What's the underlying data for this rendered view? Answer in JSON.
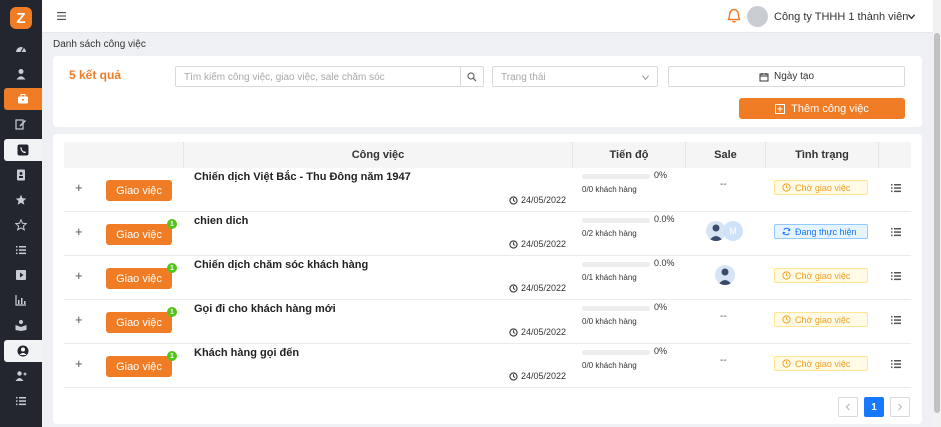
{
  "app": {
    "logo_letter": "Z"
  },
  "topbar": {
    "company": "Công ty THHH 1 thành viên"
  },
  "breadcrumb": "Danh sách công việc",
  "filters": {
    "result_count": "5 kết quả",
    "search_placeholder": "Tìm kiếm công việc, giao việc, sale chăm sóc",
    "status_placeholder": "Trạng thái",
    "date_label": "Ngày tạo",
    "add_label": "Thêm công việc"
  },
  "table": {
    "headers": {
      "task": "Công việc",
      "progress": "Tiến độ",
      "sale": "Sale",
      "status": "Tình trạng"
    },
    "rows": [
      {
        "assign_label": "Giao việc",
        "badge": "",
        "name": "Chiến dịch Việt Bắc - Thu Đông năm 1947",
        "date": "24/05/2022",
        "progress_pct": "0%",
        "progress_sub": "0/0 khách hàng",
        "sale": "--",
        "status": "Chờ giao việc"
      },
      {
        "assign_label": "Giao việc",
        "badge": "1",
        "name": "chien dich",
        "date": "24/05/2022",
        "progress_pct": "0.0%",
        "progress_sub": "0/2 khách hàng",
        "sale_avatars": [
          "user-avatar",
          "M"
        ],
        "status": "Đang thực hiện"
      },
      {
        "assign_label": "Giao việc",
        "badge": "1",
        "name": "Chiến dịch chăm sóc khách hàng",
        "date": "24/05/2022",
        "progress_pct": "0.0%",
        "progress_sub": "0/1 khách hàng",
        "sale_avatars": [
          "user-avatar"
        ],
        "status": "Chờ giao việc"
      },
      {
        "assign_label": "Giao việc",
        "badge": "1",
        "name": "Gọi đi cho khách hàng mới",
        "date": "24/05/2022",
        "progress_pct": "0%",
        "progress_sub": "0/0 khách hàng",
        "sale": "--",
        "status": "Chờ giao việc"
      },
      {
        "assign_label": "Giao việc",
        "badge": "1",
        "name": "Khách hàng gọi đến",
        "date": "24/05/2022",
        "progress_pct": "0%",
        "progress_sub": "0/0 khách hàng",
        "sale": "--",
        "status": "Chờ giao việc"
      }
    ]
  },
  "pagination": {
    "current": "1"
  },
  "colors": {
    "accent": "#f07c25",
    "sidebar": "#23262f",
    "pager_active": "#1677ff",
    "status_waiting": "#f0a020",
    "status_doing": "#1677ff"
  },
  "icons": {
    "sidebar": [
      "dashboard-icon",
      "user-icon",
      "briefcase-icon",
      "edit-note-icon",
      "phone-icon",
      "contact-card-icon",
      "star-filled-icon",
      "star-outline-icon",
      "list-icon",
      "play-icon",
      "chart-icon",
      "book-icon",
      "person-icon",
      "add-user-icon",
      "list-detail-icon"
    ]
  }
}
